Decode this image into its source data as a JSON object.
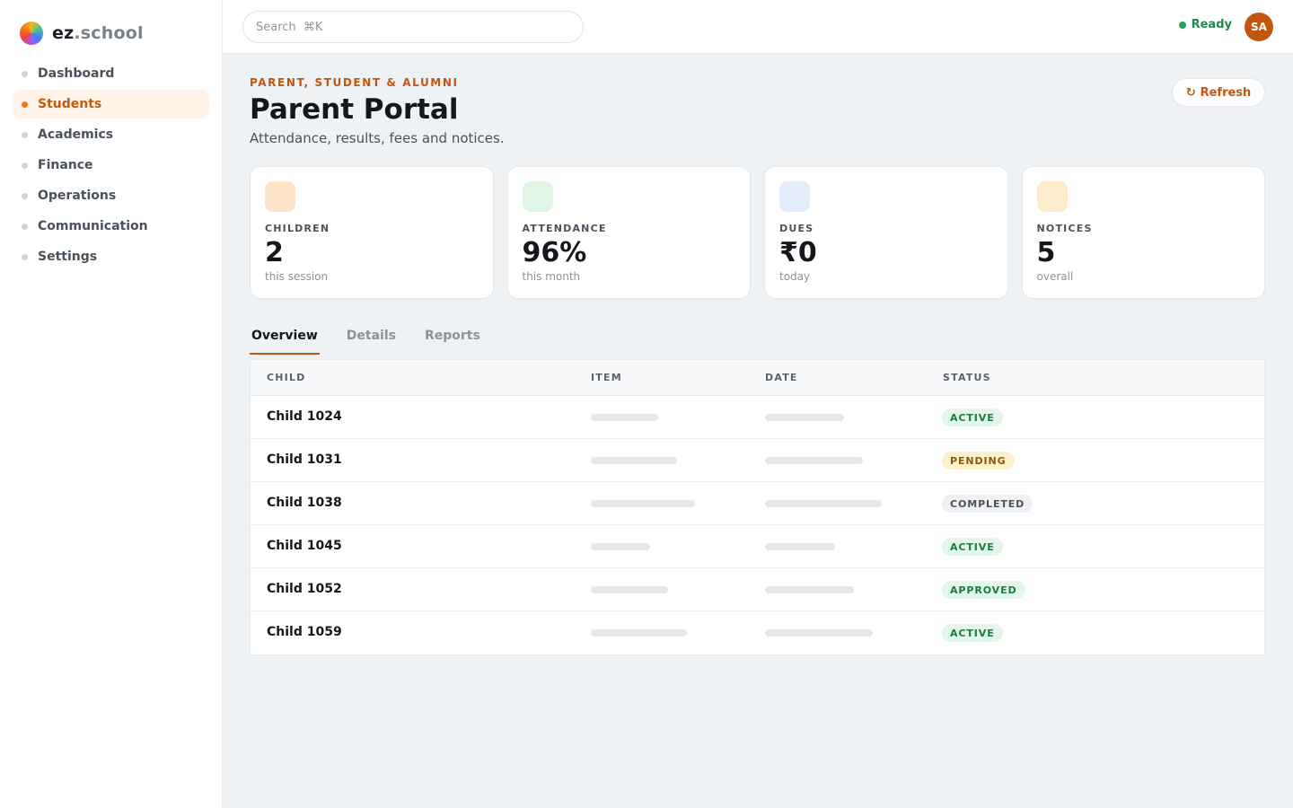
{
  "brand": {
    "name_bold": "ez",
    "name_rest": ".school"
  },
  "sidebar": {
    "items": [
      {
        "label": "Dashboard",
        "active": false
      },
      {
        "label": "Students",
        "active": true
      },
      {
        "label": "Academics",
        "active": false
      },
      {
        "label": "Finance",
        "active": false
      },
      {
        "label": "Operations",
        "active": false
      },
      {
        "label": "Communication",
        "active": false
      },
      {
        "label": "Settings",
        "active": false
      }
    ]
  },
  "topbar": {
    "search_placeholder": "Search  ⌘K",
    "status": "Ready",
    "avatar_initials": "SA"
  },
  "header": {
    "eyebrow": "PARENT, STUDENT & ALUMNI",
    "title": "Parent Portal",
    "subtitle": "Attendance, results, fees and notices.",
    "refresh_label": "Refresh"
  },
  "cards": [
    {
      "label": "CHILDREN",
      "value": "2",
      "sub": "this session",
      "chip_color": "#fde3c8"
    },
    {
      "label": "ATTENDANCE",
      "value": "96%",
      "sub": "this month",
      "chip_color": "#dff5e6"
    },
    {
      "label": "DUES",
      "value": "₹0",
      "sub": "today",
      "chip_color": "#e2ecfb"
    },
    {
      "label": "NOTICES",
      "value": "5",
      "sub": "overall",
      "chip_color": "#fdeccb"
    }
  ],
  "tabs": [
    {
      "label": "Overview",
      "active": true
    },
    {
      "label": "Details",
      "active": false
    },
    {
      "label": "Reports",
      "active": false
    }
  ],
  "table": {
    "columns": [
      "CHILD",
      "ITEM",
      "DATE",
      "STATUS"
    ],
    "rows": [
      {
        "child": "Child 1024",
        "status": "ACTIVE",
        "tone": "green"
      },
      {
        "child": "Child 1031",
        "status": "PENDING",
        "tone": "yellow"
      },
      {
        "child": "Child 1038",
        "status": "COMPLETED",
        "tone": "gray"
      },
      {
        "child": "Child 1045",
        "status": "ACTIVE",
        "tone": "green"
      },
      {
        "child": "Child 1052",
        "status": "APPROVED",
        "tone": "green"
      },
      {
        "child": "Child 1059",
        "status": "ACTIVE",
        "tone": "green"
      }
    ]
  },
  "colors": {
    "accent": "#c2560e",
    "ready": "#22a55a"
  }
}
